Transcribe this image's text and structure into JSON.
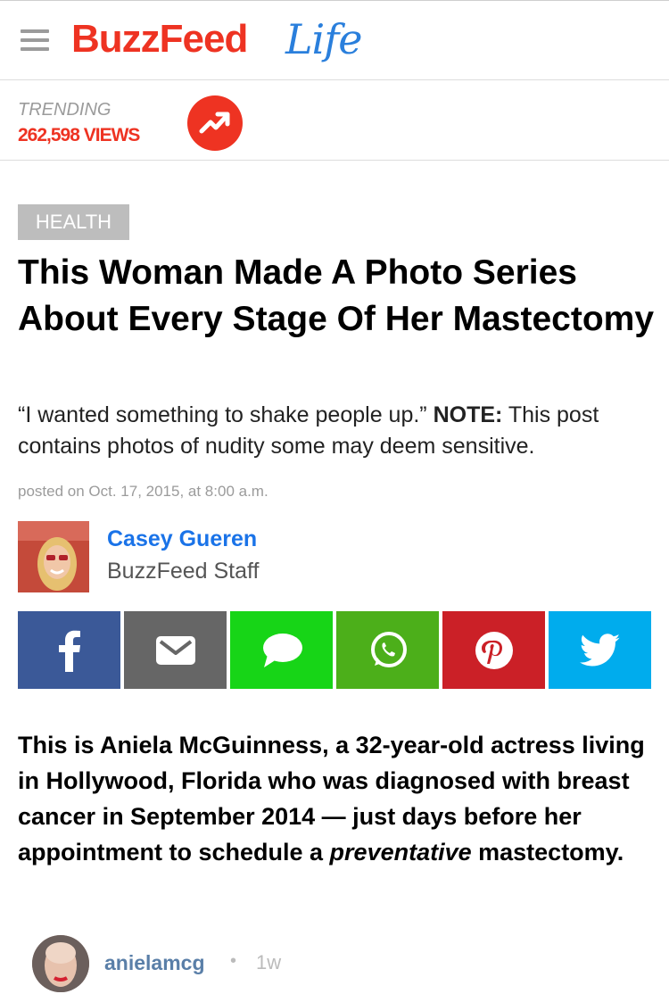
{
  "header": {
    "logo_main": "BuzzFeed",
    "logo_sub": "Life",
    "colors": {
      "brand_red": "#ee3322",
      "life_blue": "#2a7fdc"
    }
  },
  "trending": {
    "label": "TRENDING",
    "views": "262,598 VIEWS",
    "icon": "trending-arrow-icon"
  },
  "article": {
    "category": "HEALTH",
    "title": "This Woman Made A Photo Series About Every Stage Of Her Mastectomy",
    "dek_quote": "“I wanted something to shake people up.” ",
    "dek_note_label": "NOTE:",
    "dek_note_text": " This post contains photos of nudity some may deem sensitive.",
    "posted": "posted on Oct. 17, 2015, at 8:00 a.m."
  },
  "author": {
    "name": "Casey Gueren",
    "role": "BuzzFeed Staff"
  },
  "share": [
    {
      "name": "facebook",
      "icon": "facebook-icon",
      "color": "#3b5998"
    },
    {
      "name": "email",
      "icon": "mail-icon",
      "color": "#666666"
    },
    {
      "name": "sms",
      "icon": "chat-bubble-icon",
      "color": "#17d517"
    },
    {
      "name": "whatsapp",
      "icon": "whatsapp-icon",
      "color": "#4caf1a"
    },
    {
      "name": "pinterest",
      "icon": "pinterest-icon",
      "color": "#cb2027"
    },
    {
      "name": "twitter",
      "icon": "twitter-icon",
      "color": "#00aced"
    }
  ],
  "body": {
    "p1_a": "This is Aniela McGuinness, a 32-year-old actress living in Hollywood, Florida who was diagnosed with breast cancer in September 2014 — just days before her appointment to schedule a ",
    "p1_em": "preventative",
    "p1_b": " mastectomy."
  },
  "instagram": {
    "username": "anielamcg",
    "dot": "•",
    "time": "1w"
  }
}
